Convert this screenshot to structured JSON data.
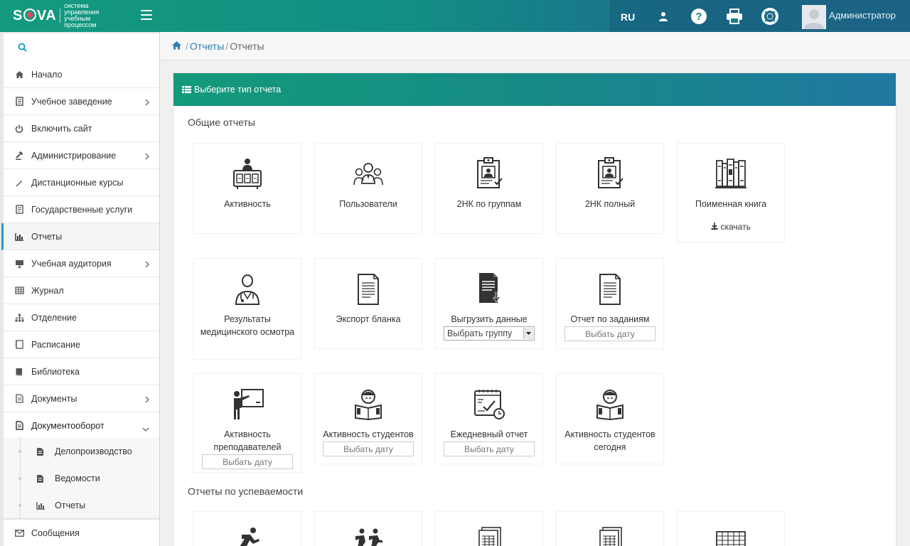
{
  "app": {
    "logo_text": "SOVA",
    "logo_tagline": "система управления учебным процессом",
    "language": "RU",
    "user_name": "Администратор"
  },
  "sidebar": {
    "items": [
      {
        "label": "Начало",
        "icon": "home-icon"
      },
      {
        "label": "Учебное заведение",
        "icon": "building-icon",
        "has_children": true
      },
      {
        "label": "Включить сайт",
        "icon": "power-icon"
      },
      {
        "label": "Администрирование",
        "icon": "gavel-icon",
        "has_children": true
      },
      {
        "label": "Дистанционные курсы",
        "icon": "pencil-icon"
      },
      {
        "label": "Государственные услуги",
        "icon": "document-icon"
      },
      {
        "label": "Отчеты",
        "icon": "bar-chart-icon",
        "active": true
      },
      {
        "label": "Учебная аудитория",
        "icon": "presentation-icon",
        "has_children": true
      },
      {
        "label": "Журнал",
        "icon": "table-icon"
      },
      {
        "label": "Отделение",
        "icon": "sitemap-icon"
      },
      {
        "label": "Расписание",
        "icon": "schedule-icon"
      },
      {
        "label": "Библиотека",
        "icon": "book-icon"
      },
      {
        "label": "Документы",
        "icon": "file-icon",
        "has_children": true
      },
      {
        "label": "Документооборот",
        "icon": "file-text-icon",
        "expanded": true
      }
    ],
    "sub_items": [
      {
        "label": "Делопроизводство",
        "icon": "file-text-icon"
      },
      {
        "label": "Ведомости",
        "icon": "file-text-icon"
      },
      {
        "label": "Отчеты",
        "icon": "bar-chart-icon"
      }
    ],
    "last_item": {
      "label": "Сообщения",
      "icon": "envelope-icon"
    }
  },
  "breadcrumb": {
    "link": "Отчеты",
    "current": "Отчеты"
  },
  "panel": {
    "title": "Выберите тип отчета",
    "section_general": "Общие отчеты",
    "section_progress": "Отчеты по успеваемости"
  },
  "reports": {
    "activity": "Активность",
    "users": "Пользователи",
    "nk_groups": "2НК по группам",
    "nk_full": "2НК полный",
    "name_book": "Поименная книга",
    "download": "скачать",
    "medical": "Результаты медицинского осмотра",
    "export_form": "Экспорт бланка",
    "export_data": "Выгрузить данные",
    "export_data_select": "Выбрать группу",
    "tasks_report": "Отчет по заданиям",
    "tasks_report_date": "Выбать дату",
    "teachers_activity": "Активность преподавателей",
    "teachers_activity_date": "Выбать дату",
    "students_activity": "Активность студентов",
    "students_activity_date": "Выбать дату",
    "daily_report": "Ежедневный отчет",
    "daily_report_date": "Выбать дату",
    "students_today": "Активность студентов сегодня"
  },
  "colors": {
    "accent": "#1b9ad6",
    "header_start": "#149a7e",
    "header_end": "#216f93",
    "link": "#2d7fb5"
  }
}
